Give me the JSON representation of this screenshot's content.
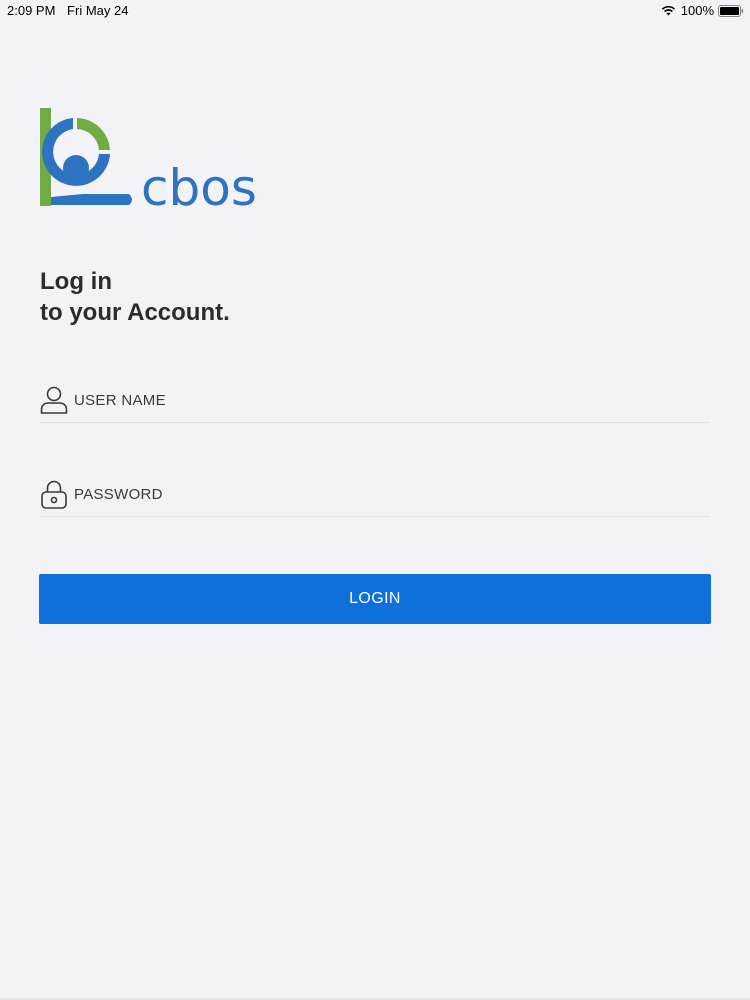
{
  "status_bar": {
    "time": "2:09 PM",
    "date": "Fri May 24",
    "battery_percent": "100%",
    "battery_level": 1.0,
    "wifi_icon": "wifi-icon",
    "battery_icon": "battery-icon"
  },
  "logo": {
    "text": "cbos",
    "green": "#72ab44",
    "blue": "#2d73c0"
  },
  "heading": {
    "line1": "Log in",
    "line2": "to your Account."
  },
  "form": {
    "username": {
      "icon": "user-icon",
      "placeholder": "USER NAME",
      "value": ""
    },
    "password": {
      "icon": "lock-icon",
      "placeholder": "PASSWORD",
      "value": ""
    },
    "login_label": "LOGIN"
  },
  "colors": {
    "background": "#f2f2f7",
    "button": "#0f6fdb",
    "text": "#2c2c2e"
  }
}
